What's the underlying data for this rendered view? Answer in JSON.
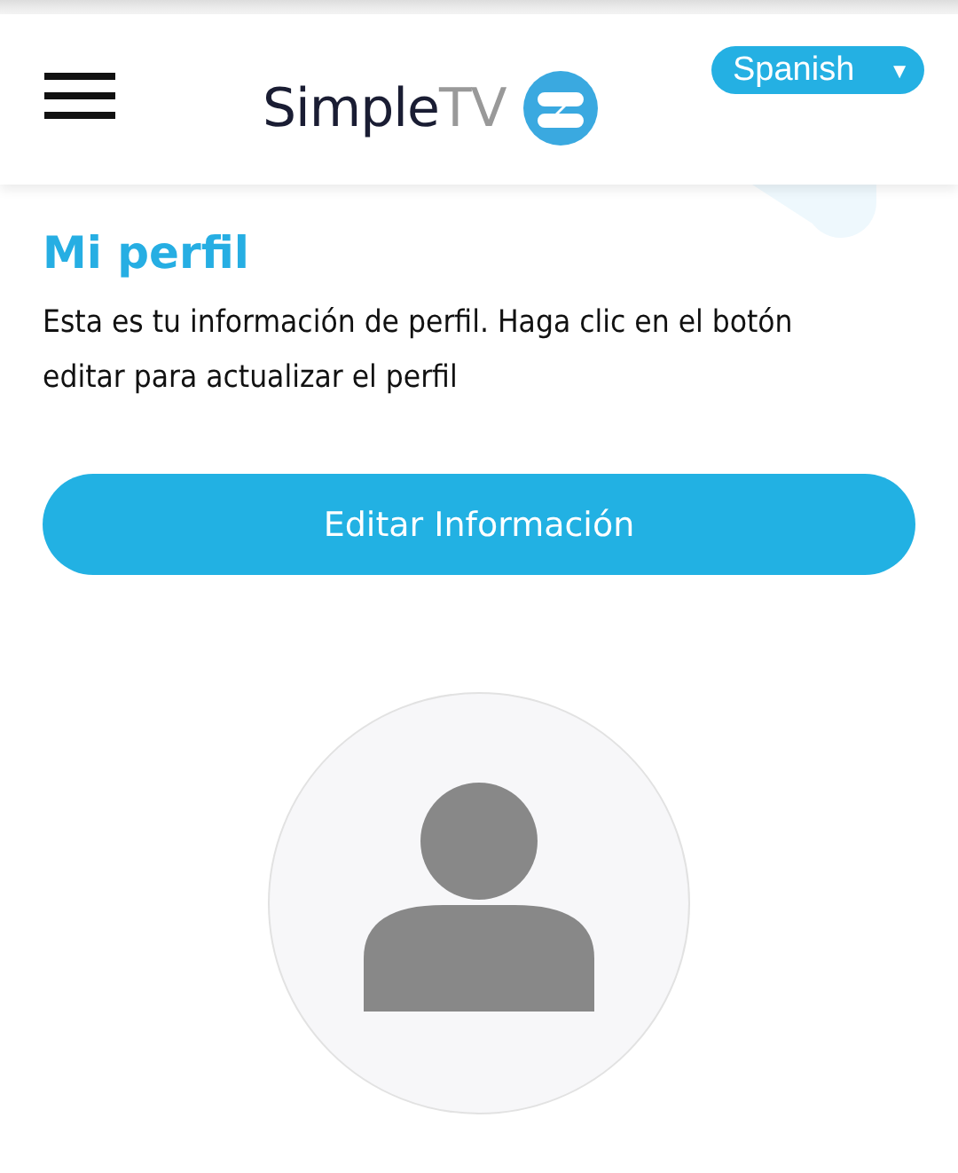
{
  "header": {
    "logo": {
      "name": "Simple",
      "accent": "TV"
    },
    "language": {
      "value": "Spanish",
      "caret": "▼"
    }
  },
  "profile": {
    "title": "Mi perfil",
    "description": "Esta es tu información de perfil. Haga clic en el botón editar para actualizar el perfil",
    "edit_button": "Editar Información",
    "avatar": {
      "kind": "placeholder"
    }
  }
}
